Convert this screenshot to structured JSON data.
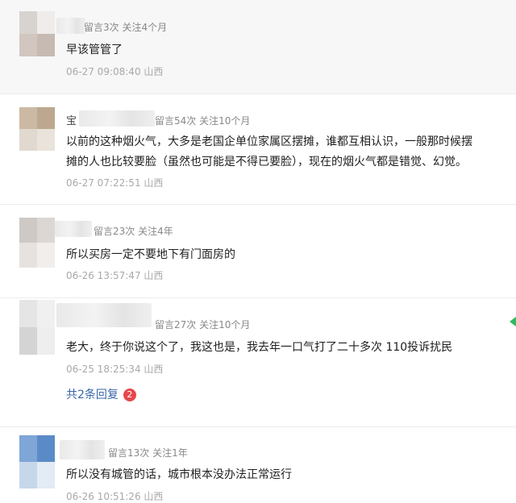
{
  "comments": [
    {
      "meta": "留言3次 关注4个月",
      "text": [
        "早该管管了"
      ],
      "time": "06-27 09:08:40 山西",
      "avatar_colors": [
        "#d9d3cf",
        "#efeceb",
        "#d1c6c0",
        "#c7bab2"
      ]
    },
    {
      "name_initial": "宝",
      "meta": "留言54次 关注10个月",
      "text": [
        "以前的这种烟火气，大多是老国企单位家属区摆摊，谁都互相认识，一般那时候摆",
        "摊的人也比较要脸（虽然也可能是不得已要脸），现在的烟火气都是错觉、幻觉。"
      ],
      "time": "06-27 07:22:51 山西",
      "avatar_colors": [
        "#cbb9a3",
        "#bda88f",
        "#e1d9cf",
        "#e9e3dc"
      ]
    },
    {
      "meta": "留言23次 关注4年",
      "text": [
        "所以买房一定不要地下有门面房的"
      ],
      "time": "06-26 13:57:47 山西",
      "avatar_colors": [
        "#cfc9c5",
        "#ddd7d3",
        "#e7e2df",
        "#f1eeec"
      ]
    },
    {
      "meta": "留言27次 关注10个月",
      "text": [
        "老大，终于你说这个了，我这也是，我去年一口气打了二十多次 110投诉扰民"
      ],
      "time": "06-25 18:25:34 山西",
      "replies": {
        "label": "共2条回复",
        "count": "2"
      },
      "avatar_colors": [
        "#e5e5e5",
        "#f0f0f0",
        "#d4d4d4",
        "#eeeeee"
      ]
    },
    {
      "meta": "留言13次 关注1年",
      "text": [
        "所以没有城管的话，城市根本没办法正常运行"
      ],
      "time": "06-26 10:51:26 山西",
      "avatar_colors": [
        "#7ea6d6",
        "#5b8bc7",
        "#c6d7ea",
        "#e3ebf4"
      ]
    }
  ]
}
